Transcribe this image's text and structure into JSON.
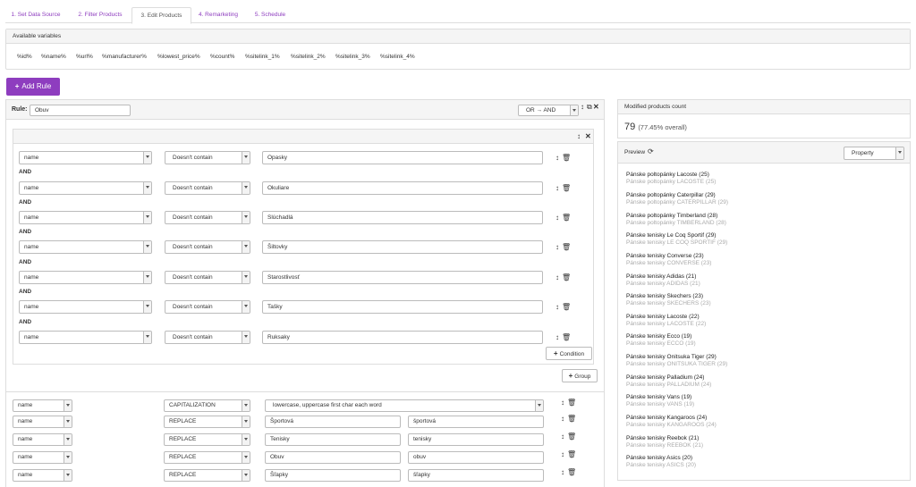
{
  "tabs": [
    "1. Set Data Source",
    "2. Filter Products",
    "3. Edit Products",
    "4. Remarketing",
    "5. Schedule"
  ],
  "variables": {
    "title": "Available variables",
    "items": [
      "%id%",
      "%name%",
      "%url%",
      "%manufacturer%",
      "%lowest_price%",
      "%count%",
      "%sitelink_1%",
      "%sitelink_2%",
      "%sitelink_3%",
      "%sitelink_4%"
    ]
  },
  "add_rule_label": "Add Rule",
  "rule": {
    "label": "Rule:",
    "name_value": "Obuv",
    "logic_select": "OR → AND",
    "conditions": [
      {
        "field": "name",
        "operator": "Doesn't contain",
        "value": "Opasky"
      },
      {
        "field": "name",
        "operator": "Doesn't contain",
        "value": "Okuliare"
      },
      {
        "field": "name",
        "operator": "Doesn't contain",
        "value": "Slúchadlá"
      },
      {
        "field": "name",
        "operator": "Doesn't contain",
        "value": "Šiltovky"
      },
      {
        "field": "name",
        "operator": "Doesn't contain",
        "value": "Starostlivosť"
      },
      {
        "field": "name",
        "operator": "Doesn't contain",
        "value": "Tašky"
      },
      {
        "field": "name",
        "operator": "Doesn't contain",
        "value": "Ruksaky"
      }
    ],
    "and_label": "AND",
    "condition_button": "Condition",
    "group_button": "Group",
    "actions": [
      {
        "field": "name",
        "action": "CAPITALIZATION",
        "value": "lowercase, uppercase first char each word",
        "replace": ""
      },
      {
        "field": "name",
        "action": "REPLACE",
        "value": "Športová",
        "replace": "športová"
      },
      {
        "field": "name",
        "action": "REPLACE",
        "value": "Tenisky",
        "replace": "tenisky"
      },
      {
        "field": "name",
        "action": "REPLACE",
        "value": "Obuv",
        "replace": "obuv"
      },
      {
        "field": "name",
        "action": "REPLACE",
        "value": "Šľapky",
        "replace": "šľapky"
      }
    ]
  },
  "modified_count": {
    "title": "Modified products count",
    "value": "79",
    "percent": "(77.45% overall)"
  },
  "preview": {
    "title": "Preview",
    "select": "Property",
    "items": [
      {
        "main": "Pánske poltopánky Lacoste (25)",
        "sub": "Pánske poltopánky LACOSTE (25)"
      },
      {
        "main": "Pánske poltopánky Caterpillar (29)",
        "sub": "Pánske poltopánky CATERPILLAR (29)"
      },
      {
        "main": "Pánske poltopánky Timberland (28)",
        "sub": "Pánske poltopánky TIMBERLAND (28)"
      },
      {
        "main": "Pánske tenisky Le Coq Sportif (29)",
        "sub": "Pánske tenisky LE COQ SPORTIF (29)"
      },
      {
        "main": "Pánske tenisky Converse (23)",
        "sub": "Pánske tenisky CONVERSE (23)"
      },
      {
        "main": "Pánske tenisky Adidas (21)",
        "sub": "Pánske tenisky ADIDAS (21)"
      },
      {
        "main": "Pánske tenisky Skechers (23)",
        "sub": "Pánske tenisky SKECHERS (23)"
      },
      {
        "main": "Pánske tenisky Lacoste (22)",
        "sub": "Pánske tenisky LACOSTE (22)"
      },
      {
        "main": "Pánske tenisky Ecco (19)",
        "sub": "Pánske tenisky ECCO (19)"
      },
      {
        "main": "Pánske tenisky Onitsuka Tiger (29)",
        "sub": "Pánske tenisky ONITSUKA TIGER (29)"
      },
      {
        "main": "Pánske tenisky Palladium (24)",
        "sub": "Pánske tenisky PALLADIUM (24)"
      },
      {
        "main": "Pánske tenisky Vans (19)",
        "sub": "Pánske tenisky VANS (19)"
      },
      {
        "main": "Pánske tenisky Kangaroos (24)",
        "sub": "Pánske tenisky KANGAROOS (24)"
      },
      {
        "main": "Pánske tenisky Reebok (21)",
        "sub": "Pánske tenisky REEBOK (21)"
      },
      {
        "main": "Pánske tenisky Asics (20)",
        "sub": "Pánske tenisky ASICS (20)"
      }
    ]
  },
  "colors": {
    "accent": "#8e3dbf"
  }
}
